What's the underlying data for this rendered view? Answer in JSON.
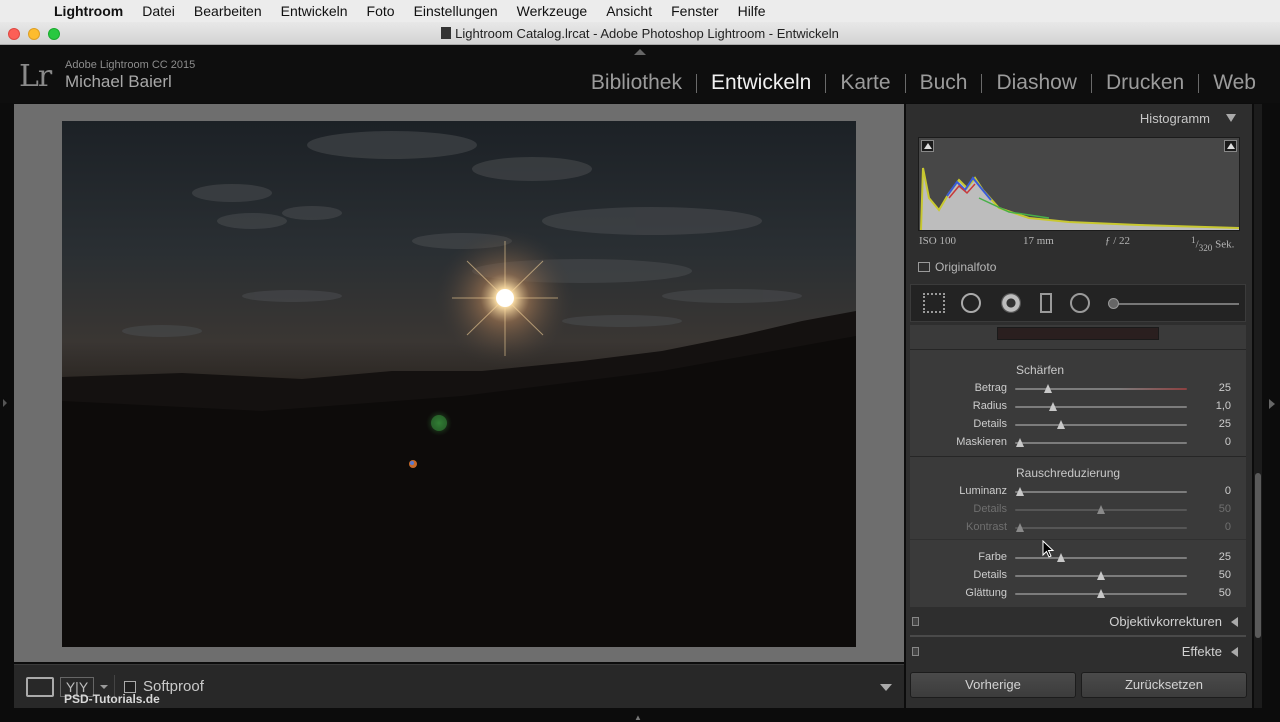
{
  "menubar": {
    "apple": "",
    "app": "Lightroom",
    "items": [
      "Datei",
      "Bearbeiten",
      "Entwickeln",
      "Foto",
      "Einstellungen",
      "Werkzeuge",
      "Ansicht",
      "Fenster",
      "Hilfe"
    ]
  },
  "window": {
    "title": "Lightroom Catalog.lrcat - Adobe Photoshop Lightroom - Entwickeln"
  },
  "identity": {
    "logo": "Lr",
    "product": "Adobe Lightroom CC 2015",
    "user": "Michael Baierl"
  },
  "modules": [
    "Bibliothek",
    "Entwickeln",
    "Karte",
    "Buch",
    "Diashow",
    "Drucken",
    "Web"
  ],
  "active_module": "Entwickeln",
  "toolbar": {
    "compare_label": "Y|Y",
    "softproof_label": "Softproof"
  },
  "watermark": "PSD-Tutorials.de",
  "histogram": {
    "title": "Histogramm",
    "exif": {
      "iso": "ISO 100",
      "focal": "17 mm",
      "aperture": "ƒ / 22",
      "shutter_num": "1",
      "shutter_den": "320",
      "shutter_unit": "Sek."
    },
    "original_label": "Originalfoto"
  },
  "tools": [
    "crop-overlay",
    "spot-removal",
    "red-eye",
    "graduated-filter",
    "radial-filter",
    "adjustment-brush"
  ],
  "detail": {
    "sharpen_title": "Schärfen",
    "sharpen": [
      {
        "label": "Betrag",
        "value": "25",
        "pos": 0.19
      },
      {
        "label": "Radius",
        "value": "1,0",
        "pos": 0.22
      },
      {
        "label": "Details",
        "value": "25",
        "pos": 0.27
      },
      {
        "label": "Maskieren",
        "value": "0",
        "pos": 0.03
      }
    ],
    "noise_title": "Rauschreduzierung",
    "noise": [
      {
        "label": "Luminanz",
        "value": "0",
        "pos": 0.03
      },
      {
        "label": "Details",
        "value": "50",
        "pos": 0.5
      },
      {
        "label": "Kontrast",
        "value": "0",
        "pos": 0.03
      },
      {
        "label": "Farbe",
        "value": "25",
        "pos": 0.27
      },
      {
        "label": "Details",
        "value": "50",
        "pos": 0.5
      },
      {
        "label": "Glättung",
        "value": "50",
        "pos": 0.5
      }
    ]
  },
  "panels": {
    "lens": "Objektivkorrekturen",
    "effects": "Effekte"
  },
  "buttons": {
    "previous": "Vorherige",
    "reset": "Zurücksetzen"
  },
  "colors": {
    "active": "#f0f0f0",
    "inactive": "#9b9b9b",
    "panel_bg": "#2e2e2e",
    "canvas_bg": "#6e6e6e"
  }
}
